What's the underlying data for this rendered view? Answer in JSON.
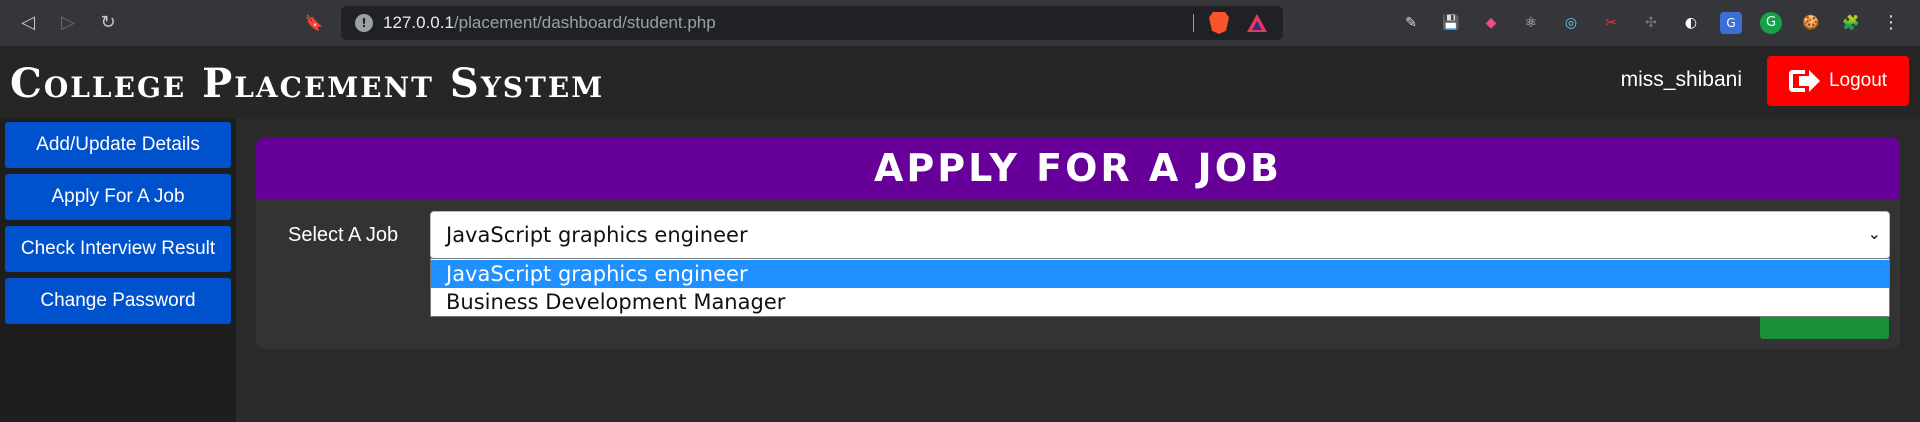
{
  "browser": {
    "url_host": "127.0.0.1",
    "url_path": "/placement/dashboard/student.php",
    "nav": {
      "back": "◁",
      "forward": "▷",
      "reload": "↻",
      "bookmark": "🔖"
    },
    "extensions": [
      "✎",
      "💾",
      "◆",
      "⚛",
      "◎",
      "✂",
      "✣",
      "◐",
      "G",
      "G",
      "🍪",
      "🧩",
      "⋮"
    ]
  },
  "header": {
    "title": "College Placement System",
    "username": "miss_shibani",
    "logout_label": "Logout"
  },
  "sidebar": {
    "items": [
      {
        "label": "Add/Update Details"
      },
      {
        "label": "Apply For A Job"
      },
      {
        "label": "Check Interview Result"
      },
      {
        "label": "Change Password"
      }
    ]
  },
  "main": {
    "card_title": "APPLY FOR A JOB",
    "job_field_label": "Select A Job",
    "selected_job": "JavaScript graphics engineer",
    "chevron": "⌄",
    "job_options": [
      {
        "label": "JavaScript graphics engineer",
        "selected": true
      },
      {
        "label": "Business Development Manager",
        "selected": false
      }
    ]
  },
  "colors": {
    "card_header": "#660099",
    "sidebar_button": "#0052cc",
    "logout_button": "#ff0000",
    "submit_button": "#1a8f3a",
    "option_highlight": "#1e90ff"
  }
}
